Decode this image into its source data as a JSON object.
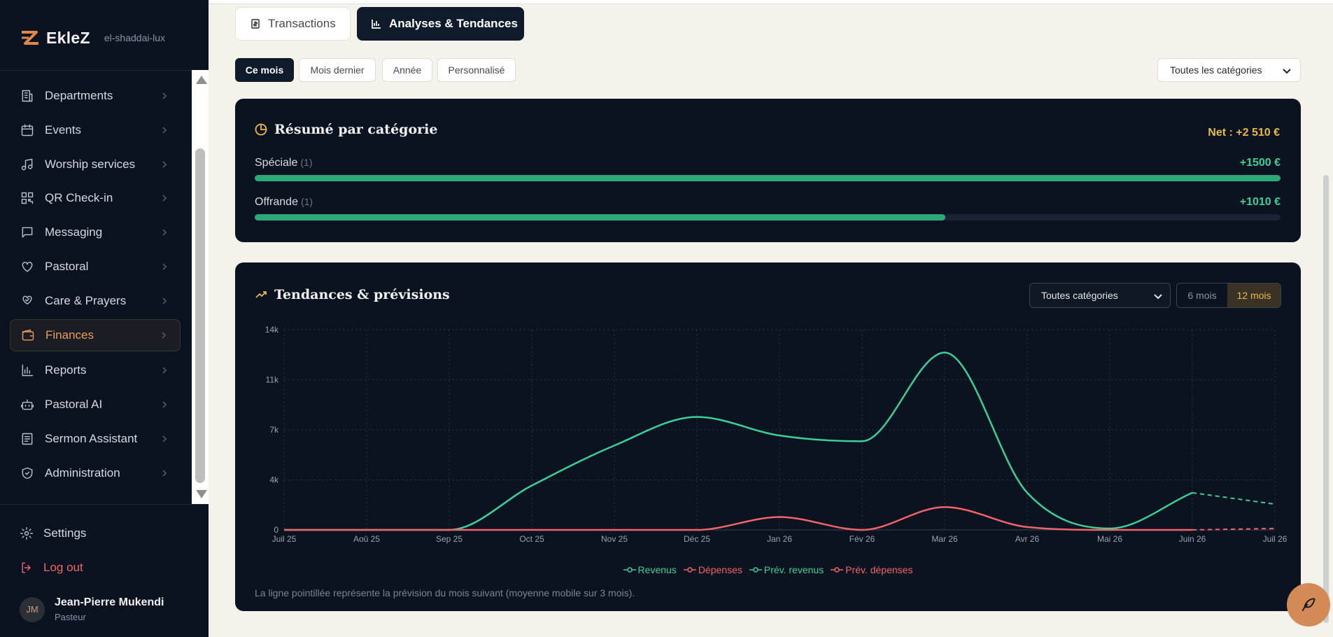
{
  "brand": {
    "name": "EkleZ",
    "tenant": "el-shaddai-lux"
  },
  "sidebar": {
    "items": [
      {
        "label": "Departments",
        "icon": "building-icon"
      },
      {
        "label": "Events",
        "icon": "calendar-icon"
      },
      {
        "label": "Worship services",
        "icon": "music-icon"
      },
      {
        "label": "QR Check-in",
        "icon": "qr-code-icon"
      },
      {
        "label": "Messaging",
        "icon": "message-icon"
      },
      {
        "label": "Pastoral",
        "icon": "heart-icon"
      },
      {
        "label": "Care & Prayers",
        "icon": "hand-heart-icon"
      },
      {
        "label": "Finances",
        "icon": "wallet-icon",
        "active": true
      },
      {
        "label": "Reports",
        "icon": "bar-chart-icon"
      },
      {
        "label": "Pastoral AI",
        "icon": "bot-icon"
      },
      {
        "label": "Sermon Assistant",
        "icon": "document-icon"
      },
      {
        "label": "Administration",
        "icon": "shield-icon"
      }
    ],
    "settings_label": "Settings",
    "logout_label": "Log out",
    "user": {
      "initials": "JM",
      "name": "Jean-Pierre Mukendi",
      "role": "Pasteur"
    }
  },
  "tabs": {
    "transactions": "Transactions",
    "analyses": "Analyses & Tendances"
  },
  "periods": [
    "Ce mois",
    "Mois dernier",
    "Année",
    "Personnalisé"
  ],
  "category_filter": "Toutes les catégories",
  "summary": {
    "title": "Résumé par catégorie",
    "net": "Net : +2 510 €",
    "rows": [
      {
        "name": "Spéciale",
        "count": "(1)",
        "value": "+1500 €",
        "fraction": 1.0
      },
      {
        "name": "Offrande",
        "count": "(1)",
        "value": "+1010 €",
        "fraction": 0.673
      }
    ]
  },
  "trends": {
    "title": "Tendances & prévisions",
    "category_select": "Toutes catégories",
    "range_6": "6 mois",
    "range_12": "12 mois",
    "footnote": "La ligne pointillée représente la prévision du mois suivant (moyenne mobile sur 3 mois)."
  },
  "colors": {
    "revenue": "#3ecf98",
    "expense": "#f0646a",
    "accent": "#e8b94a",
    "active_nav": "#e89a5c"
  },
  "chart_data": {
    "type": "line",
    "categories": [
      "Juil 25",
      "Aoû 25",
      "Sep 25",
      "Oct 25",
      "Nov 25",
      "Déc 25",
      "Jan 26",
      "Fév 26",
      "Mar 26",
      "Avr 26",
      "Mai 26",
      "Juin 26",
      "Juil 26"
    ],
    "y_ticks": [
      "0",
      "4k",
      "7k",
      "11k",
      "14k"
    ],
    "ylim": [
      0,
      14000
    ],
    "grid": true,
    "legend_position": "bottom",
    "series": [
      {
        "name": "Revenus",
        "values": [
          0,
          0,
          0,
          3100,
          5900,
          7900,
          6600,
          6200,
          12400,
          2600,
          100,
          2600,
          null
        ]
      },
      {
        "name": "Dépenses",
        "values": [
          0,
          0,
          0,
          0,
          0,
          0,
          900,
          0,
          1600,
          200,
          0,
          0,
          null
        ]
      },
      {
        "name": "Prév. revenus",
        "values": [
          null,
          null,
          null,
          null,
          null,
          null,
          null,
          null,
          null,
          null,
          null,
          2600,
          1800
        ],
        "dashed": true
      },
      {
        "name": "Prév. dépenses",
        "values": [
          null,
          null,
          null,
          null,
          null,
          null,
          null,
          null,
          null,
          null,
          null,
          0,
          100
        ],
        "dashed": true
      }
    ]
  }
}
